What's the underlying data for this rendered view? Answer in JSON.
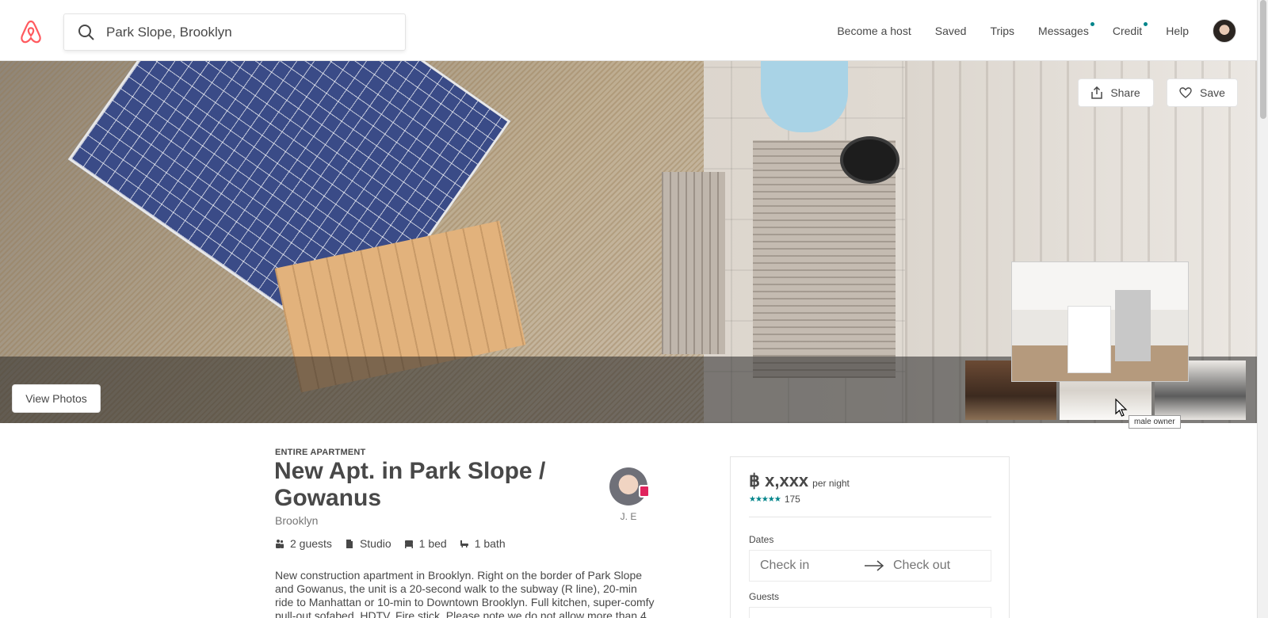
{
  "header": {
    "search_value": "Park Slope, Brooklyn",
    "nav": [
      {
        "label": "Become a host",
        "dot": false
      },
      {
        "label": "Saved",
        "dot": false
      },
      {
        "label": "Trips",
        "dot": false
      },
      {
        "label": "Messages",
        "dot": true
      },
      {
        "label": "Credit",
        "dot": true
      },
      {
        "label": "Help",
        "dot": false
      }
    ]
  },
  "hero": {
    "share_label": "Share",
    "save_label": "Save",
    "view_photos_label": "View Photos",
    "tooltip": "male owner"
  },
  "listing": {
    "type": "ENTIRE APARTMENT",
    "title": "New Apt. in Park Slope / Gowanus",
    "city": "Brooklyn",
    "host_name": "J. E",
    "amenities": {
      "guests": "2 guests",
      "room": "Studio",
      "beds": "1 bed",
      "baths": "1 bath"
    },
    "description": "New construction apartment in Brooklyn. Right on the border of Park Slope and Gowanus, the unit is a 20-second walk to the subway (R line), 20-min ride to Manhattan or 10-min to Downtown Brooklyn. Full kitchen, super-comfy pull-out sofabed, HDTV, Fire stick. Please note we do not allow more than 4"
  },
  "booking": {
    "price": "฿ x,xxx",
    "price_unit": "per night",
    "stars": "★★★★★",
    "review_count": "175",
    "dates_label": "Dates",
    "check_in_placeholder": "Check in",
    "check_out_placeholder": "Check out",
    "guests_label": "Guests"
  },
  "colors": {
    "brand": "#FF5A5F",
    "accent": "#00848A",
    "text": "#484848"
  },
  "icons": [
    "airbnb-logo-icon",
    "search-icon",
    "share-icon",
    "heart-icon",
    "arrow-right-icon",
    "guests-icon",
    "studio-icon",
    "bed-icon",
    "bath-icon"
  ]
}
